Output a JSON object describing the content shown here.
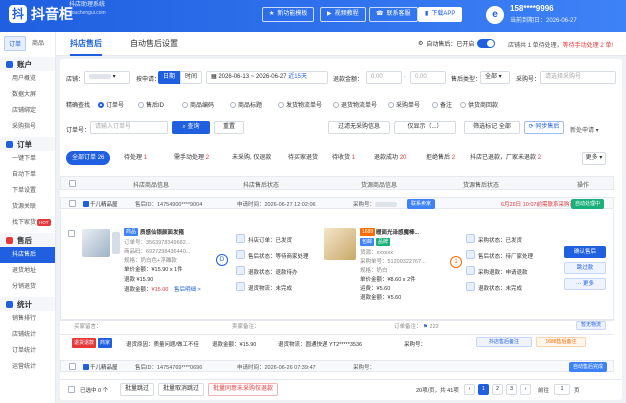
{
  "header": {
    "logo_mark": "抖",
    "brand": "抖音柜",
    "subtitle": "抖店助理系统",
    "url": "douchengui.com",
    "buttons": {
      "new_template": "新功能模板",
      "video_tutorial": "视频教程",
      "contact": "联系客服",
      "download": "下载APP"
    },
    "avatar_mark": "e",
    "user_phone": "158****9996",
    "user_expire": "当前到期日：2026-06-27"
  },
  "sidebar": {
    "tabs": [
      "订单",
      "商品"
    ],
    "groups": [
      {
        "title": "账户",
        "items": [
          "用户概览",
          "数据大屏",
          "店铺绑定",
          "采购指号"
        ]
      },
      {
        "title": "订单",
        "items": [
          "一键下单",
          "自动下单",
          "下单设置",
          "货源关联",
          "找下家货"
        ]
      },
      {
        "title": "售后",
        "items": [
          "抖店售后",
          "退货地址",
          "分销退货"
        ]
      },
      {
        "title": "统计",
        "items": [
          "销售排行",
          "店铺统计",
          "订单统计",
          "运营统计"
        ]
      }
    ],
    "hot_badge": "HOT",
    "active_item": "抖店售后"
  },
  "main": {
    "tabs": {
      "aftersale": "抖店售后",
      "auto_settings": "自动售后设置"
    },
    "auto": {
      "label": "自动售后：已开启"
    },
    "notice": {
      "prefix": "店铺共 1 单待处理，",
      "highlight": "等待手动处理 2 单!"
    }
  },
  "filters": {
    "shop_label": "店铺：",
    "time_label": "按申请：",
    "seg_day": "日期",
    "seg_time": "时间",
    "date_from": "2026-06-13",
    "date_to": "2026-06-27",
    "range": "近15天",
    "refund_label": "退款金额：",
    "refund_from": "0.00",
    "refund_to": "0.00",
    "type_label": "售后类型：",
    "type_value": "全部",
    "purchase_label": "采购号：",
    "purchase_ph": "请选择采购号",
    "match_label": "精确查找",
    "radios": [
      "订单号",
      "售后ID",
      "商品编码",
      "商品标题",
      "发货物流单号",
      "退货物流单号",
      "采购单号",
      "备注",
      "供货商回款"
    ],
    "order_label": "订单号：",
    "order_ph": "请输入订单号",
    "query": "查询",
    "reset": "重置",
    "filter_purchased": "过滤无采购信息",
    "filter_show": "仅显示（...）",
    "filter_flag": "筛选标记 全部",
    "sync": "同步售后",
    "new_notice": "新处申请"
  },
  "status_tabs": [
    {
      "label": "全部订单",
      "count": "26"
    },
    {
      "label": "待处理",
      "count": "1"
    },
    {
      "label": "需手动处理",
      "count": "2"
    },
    {
      "label": "未采购, 仅退款",
      "count": ""
    },
    {
      "label": "待买家退货",
      "count": ""
    },
    {
      "label": "待收货",
      "count": "1"
    },
    {
      "label": "退款成功",
      "count": "20"
    },
    {
      "label": "拒绝售后",
      "count": "2"
    },
    {
      "label": "抖店已退款，厂家未退款",
      "count": "2"
    }
  ],
  "more": "更多",
  "table": {
    "columns": [
      "抖店商品信息",
      "抖店售后状态",
      "货源商品信息",
      "货源售后状态",
      "操作"
    ]
  },
  "orders": [
    {
      "shop": "千儿精品屋",
      "aftersale_id": "售后ID：14754900****9004",
      "apply_time": "申请时间：2026-06-27 12:02:06",
      "purchase_label": "采购号：",
      "contact": "联系卖家",
      "deadline": "6月26日 10:07前需联系采购商备注",
      "badge": "自动处理中",
      "product": {
        "tag": "商品",
        "title": "质感仙银颜面发箍",
        "code_line": "订单号：3563978349682...",
        "code_line2": "商品码：6927298436440...",
        "spec": "规格：奶白色+浮雕款",
        "price": "单价金额：¥15.90 x 1件",
        "refund_label": "退款",
        "refund": "¥15.90",
        "refund_amount_label": "退款金额：",
        "refund_amount": "¥15.00",
        "view": "售后明细 >"
      },
      "status": {
        "refund_apply": "抖店订单：",
        "refund_apply_v": "已发货",
        "aftersale": "售后状态：",
        "aftersale_v": "等待商家处理",
        "refund_s": "退款状态：",
        "refund_s_v": "退款待办",
        "pay": "退货物流：",
        "pay_v": "未完成"
      },
      "source": {
        "tag": "1688",
        "title": "暖面光泽感魔棒...",
        "badge1": "包邮",
        "badge2": "品牌",
        "shop": "货源：xxxxxx",
        "order": "采购单号：51200322767...",
        "spec": "规格：奶白",
        "price": "单价金额：¥8.60 x 2件",
        "ship": "运费：",
        "ship_v": "¥5.60",
        "refund": "退款金额：",
        "refund_v": "¥5.60"
      },
      "source_status": {
        "s1": "采购状态：",
        "s1v": "已发货",
        "s2": "售后状态：",
        "s2v": "待厂家处理",
        "s3": "采购退款：",
        "s3v": "申请退款",
        "s4": "退款状态：",
        "s4v": "未完成"
      },
      "actions": {
        "confirm": "确认售后",
        "skip": "跳过款",
        "more": "更多"
      },
      "remark": "买家留言：",
      "seller_note": "卖家备注：",
      "order_note": "订单备注：",
      "copy_note": "暂无物流",
      "after_note": "抖店售后备注",
      "link_note": "1688售后备注"
    }
  ],
  "detail_bar": {
    "tag1": "退货退款",
    "tag2": "商家",
    "reason": "退货原因：",
    "reason_v": "质量问题/做工不佳",
    "amount": "退款金额：",
    "amount_v": "¥15.90",
    "logistics": "退货物流：",
    "logistics_v": "圆通快递 YT2*****3536",
    "purchase": "采购号："
  },
  "order2": {
    "shop": "千儿精品屋",
    "aftersale_id": "售后ID：14754769****0696",
    "apply_time": "申请时间：2026-06-26 07:39:47",
    "purchase": "采购号：",
    "badge": "自动售后完成"
  },
  "footer": {
    "selected": "已选中 0 个",
    "btn1": "批量跳过",
    "btn2": "批量取消跳过",
    "btn3": "批量同意未采购仅退款",
    "summary": "20项/页，共 41项",
    "pages": [
      "1",
      "2",
      "3"
    ],
    "next": "前往",
    "page_input": "1",
    "page_unit": "页"
  }
}
